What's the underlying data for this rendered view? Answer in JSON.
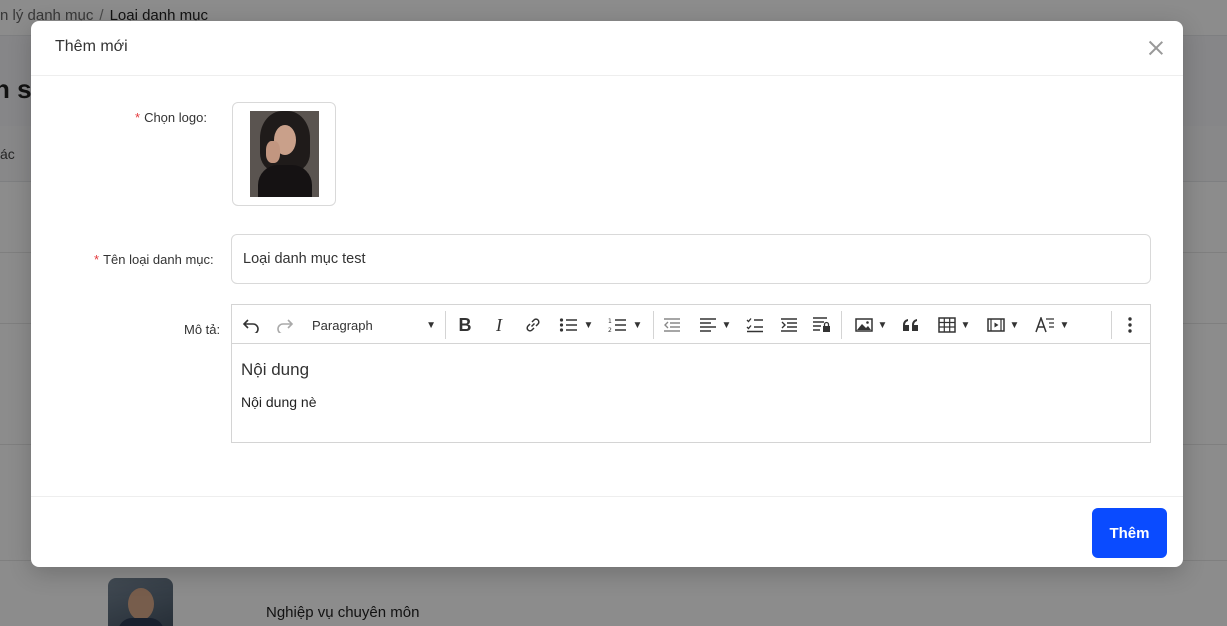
{
  "background": {
    "breadcrumb": {
      "prev": "n lý danh mục",
      "sep": "/",
      "current": "Loại danh mục"
    },
    "page_title": "n s",
    "table_header_text": "ác",
    "row_text": "Nghiệp vụ chuyên môn"
  },
  "modal": {
    "title": "Thêm mới",
    "form": {
      "logo_label": "Chọn logo",
      "name_label": "Tên loại danh mục",
      "name_value": "Loại danh mục test",
      "desc_label": "Mô tả",
      "label_suffix": ":",
      "required_mark": "*"
    },
    "editor": {
      "toolbar": {
        "undo_icon": "undo-icon",
        "redo_icon": "redo-icon",
        "paragraph": "Paragraph",
        "bold": "B",
        "italic": "I",
        "icons": [
          "link-icon",
          "bulleted-list-icon",
          "numbered-list-icon",
          "outdent-icon",
          "align-icon",
          "todo-list-icon",
          "indent-icon",
          "restricted-editing-icon",
          "image-icon",
          "blockquote-icon",
          "table-icon",
          "media-icon",
          "text-style-icon",
          "more-icon"
        ]
      },
      "heading": "Nội dung",
      "paragraph": "Nội dung nè"
    },
    "submit_label": "Thêm"
  },
  "colors": {
    "primary": "#0a4bff",
    "required": "#e4393c"
  }
}
